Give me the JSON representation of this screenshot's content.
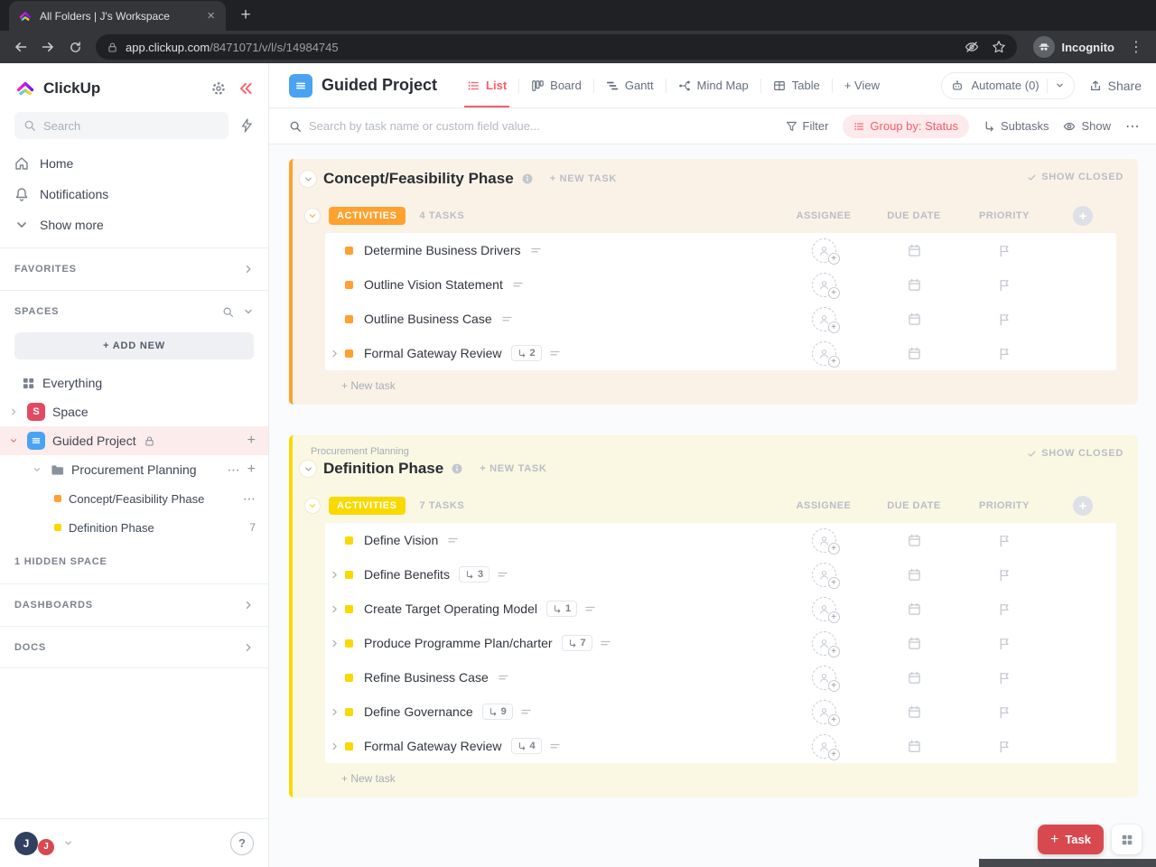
{
  "colors": {
    "accent_red": "#fd5b68",
    "button_red": "#d8494f",
    "blue": "#4aa3f2",
    "orange": "#ffa12f",
    "yellow": "#f9d900"
  },
  "browser": {
    "tab_title": "All Folders | J's Workspace",
    "close_glyph": "×",
    "new_tab_glyph": "+",
    "url_domain": "app.clickup.com",
    "url_path": "/8471071/v/l/s/14984745",
    "incognito_label": "Incognito",
    "menu_glyph": "⋮"
  },
  "sidebar": {
    "logo_text": "ClickUp",
    "search_placeholder": "Search",
    "home": "Home",
    "notifications": "Notifications",
    "show_more": "Show more",
    "favorites": "FAVORITES",
    "spaces": "SPACES",
    "add_new": "+ ADD NEW",
    "everything": "Everything",
    "space": "Space",
    "space_avatar": "S",
    "project": "Guided Project",
    "folder": "Procurement Planning",
    "phase1": "Concept/Feasibility Phase",
    "phase2": "Definition Phase",
    "phase2_count": "7",
    "hidden_space": "1 HIDDEN SPACE",
    "dashboards": "DASHBOARDS",
    "docs": "DOCS",
    "more_glyph": "⋯",
    "plus_glyph": "+",
    "help_glyph": "?",
    "user_initial": "J",
    "user_badge": "J"
  },
  "header": {
    "title": "Guided Project",
    "view_list": "List",
    "view_board": "Board",
    "view_gantt": "Gantt",
    "view_mindmap": "Mind Map",
    "view_table": "Table",
    "add_view": "+ View",
    "automate": "Automate (0)",
    "share": "Share"
  },
  "toolbar": {
    "search_placeholder": "Search by task name or custom field value...",
    "filter": "Filter",
    "group_by": "Group by: Status",
    "subtasks": "Subtasks",
    "show": "Show",
    "more_glyph": "⋯"
  },
  "list": {
    "new_task": "+ NEW TASK",
    "show_closed": "SHOW CLOSED",
    "columns": [
      "ASSIGNEE",
      "DUE DATE",
      "PRIORITY"
    ],
    "add_column_glyph": "+",
    "footer_new_task": "+ New task"
  },
  "groups": [
    {
      "breadcrumb": "",
      "title": "Concept/Feasibility Phase",
      "status": "ACTIVITIES",
      "count_label": "4 TASKS",
      "color": "#ffa12f",
      "tint": "#fbf2e7",
      "tasks": [
        {
          "name": "Determine Business Drivers"
        },
        {
          "name": "Outline Vision Statement"
        },
        {
          "name": "Outline Business Case"
        },
        {
          "name": "Formal Gateway Review",
          "subtasks": "2",
          "expand": true
        }
      ]
    },
    {
      "breadcrumb": "Procurement Planning",
      "title": "Definition Phase",
      "status": "ACTIVITIES",
      "count_label": "7 TASKS",
      "color": "#f9d900",
      "tint": "#faf7e3",
      "tasks": [
        {
          "name": "Define Vision"
        },
        {
          "name": "Define Benefits",
          "subtasks": "3",
          "expand": true
        },
        {
          "name": "Create Target Operating Model",
          "subtasks": "1",
          "expand": true
        },
        {
          "name": "Produce Programme Plan/charter",
          "subtasks": "7",
          "expand": true
        },
        {
          "name": "Refine Business Case"
        },
        {
          "name": "Define Governance",
          "subtasks": "9",
          "expand": true
        },
        {
          "name": "Formal Gateway Review",
          "subtasks": "4",
          "expand": true
        }
      ]
    }
  ],
  "fab": {
    "plus_glyph": "+",
    "task_label": "Task"
  }
}
